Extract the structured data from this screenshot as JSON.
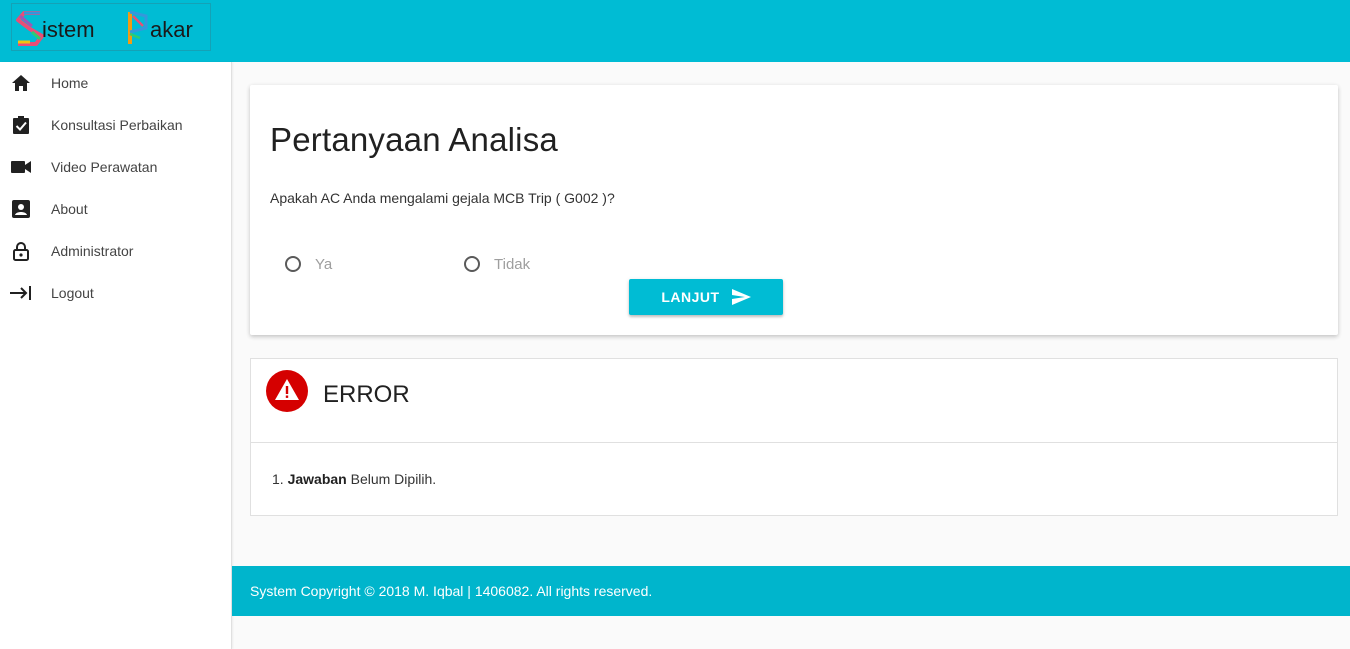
{
  "header": {
    "logo_text": "Sistem Pakar",
    "bg_color": "#00bcd4"
  },
  "sidebar": {
    "items": [
      {
        "label": "Home",
        "icon": "home-icon"
      },
      {
        "label": "Konsultasi Perbaikan",
        "icon": "clipboard-check-icon"
      },
      {
        "label": "Video Perawatan",
        "icon": "videocam-icon"
      },
      {
        "label": "About",
        "icon": "account-box-icon"
      },
      {
        "label": "Administrator",
        "icon": "lock-icon"
      },
      {
        "label": "Logout",
        "icon": "logout-icon"
      }
    ]
  },
  "question_card": {
    "title": "Pertanyaan Analisa",
    "question": "Apakah AC Anda mengalami gejala MCB Trip ( G002 )?",
    "options": [
      {
        "label": "Ya",
        "selected": false
      },
      {
        "label": "Tidak",
        "selected": false
      }
    ],
    "submit_label": "LANJUT",
    "submit_icon": "send-icon"
  },
  "error_box": {
    "title": "ERROR",
    "icon": "warning-icon",
    "icon_color": "#d50000",
    "message_number": "1.",
    "message_bold": "Jawaban",
    "message_rest": "Belum Dipilih."
  },
  "footer": {
    "text": "System Copyright © 2018 M. Iqbal | 1406082. All rights reserved."
  }
}
